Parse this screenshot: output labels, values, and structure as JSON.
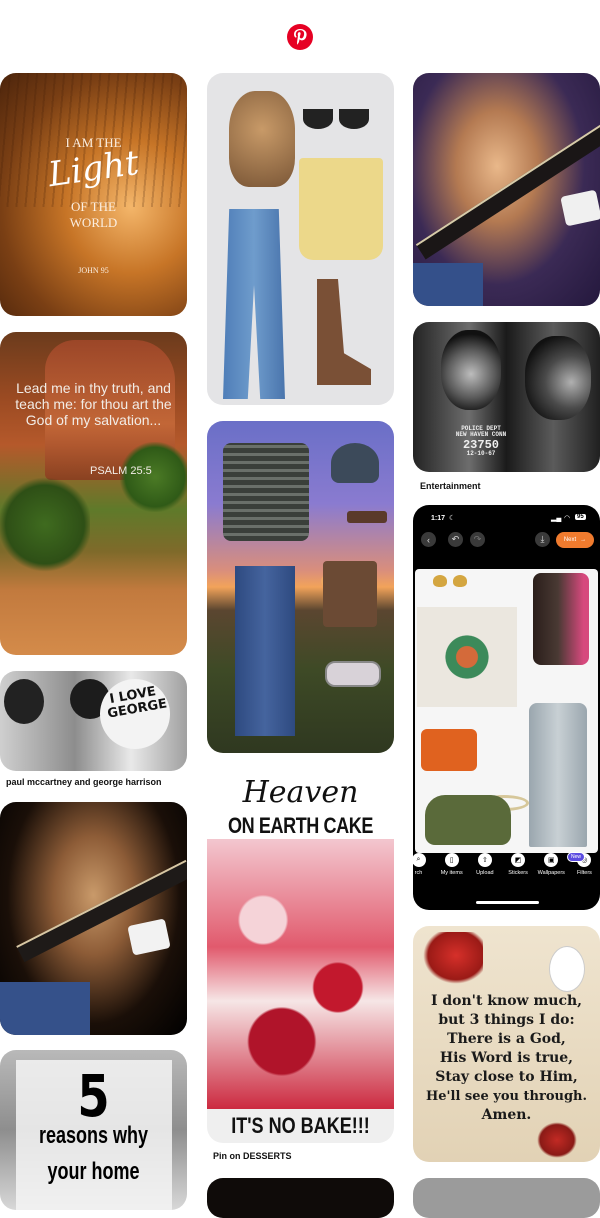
{
  "header": {
    "logo": "pinterest-logo",
    "logo_color": "#e60023"
  },
  "pins": {
    "light_world": {
      "line1": "I AM THE",
      "line2": "Light",
      "line3": "OF THE",
      "line4": "WORLD",
      "ref": "JOHN 95"
    },
    "psalm": {
      "text": "Lead me in thy truth, and teach me: for thou art the God of my salvation...",
      "ref": "PSALM 25:5"
    },
    "beatles": {
      "sign": "I LOVE GEORGE",
      "caption": "paul mccartney and george harrison"
    },
    "guitarist_left": {},
    "home": {
      "number": "5",
      "line1": "reasons why",
      "line2": "your home"
    },
    "outfit_yellow": {},
    "outfit_sunset": {},
    "cake": {
      "script": "Heaven",
      "title": "ON EARTH CAKE",
      "bottom": "IT'S NO BAKE!!!",
      "caption": "Pin on DESSERTS"
    },
    "guitarist_right": {},
    "mugshot": {
      "plate1": "POLICE DEPT",
      "plate2": "NEW HAVEN CONN",
      "plate3": "23750",
      "plate4": "12-10-67",
      "caption": "Entertainment"
    },
    "phone": {
      "time": "1:17",
      "battery": "95",
      "next_label": "Next",
      "tools": [
        {
          "label": "rch",
          "icon": "search-icon"
        },
        {
          "label": "My items",
          "icon": "bookmark-icon"
        },
        {
          "label": "Upload",
          "icon": "upload-icon"
        },
        {
          "label": "Stickers",
          "icon": "sticker-icon"
        },
        {
          "label": "Wallpapers",
          "icon": "wallpaper-icon"
        },
        {
          "label": "Filters",
          "icon": "filter-icon"
        }
      ],
      "new_badge": "New"
    },
    "cardinal": {
      "lines": [
        "I don't know much,",
        "but 3 things I do:",
        "There is a God,",
        "His Word is true,",
        "Stay close to Him,",
        "He'll see you through.",
        "Amen."
      ]
    }
  }
}
